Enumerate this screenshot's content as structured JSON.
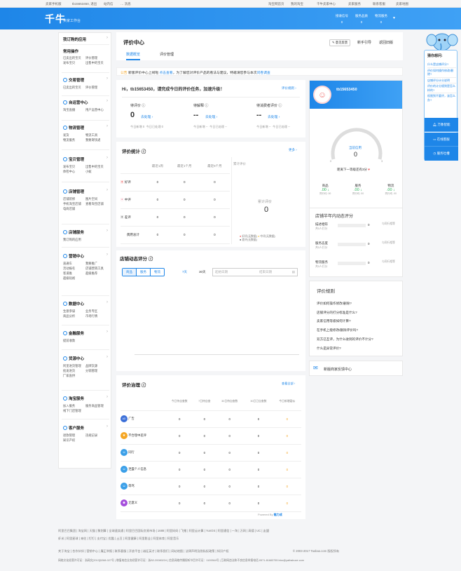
{
  "topbar": {
    "left": [
      "卖家手机版",
      "tb15653450, 退出",
      "站内信",
      "… 消息"
    ],
    "right": [
      "淘宝网首页",
      "我的淘宝",
      "千牛卖家中心",
      "卖家服务",
      "联系客服",
      "卖家地图"
    ]
  },
  "header": {
    "logo": "千牛",
    "sublogo": "卖家工作台",
    "stats": [
      {
        "label": "接收信号",
        "value": "0"
      },
      {
        "label": "服务品质",
        "value": "0"
      },
      {
        "label": "物流服务",
        "value": "0"
      }
    ]
  },
  "sidebar": {
    "top": "我订购的应用",
    "sections": [
      {
        "title": "常用操作",
        "items": [
          "已卖出的宝贝",
          "评价管理",
          "发布宝贝",
          "出售中的宝贝"
        ]
      },
      {
        "title": "交易管理",
        "items": [
          "已卖出的宝贝",
          "评价管理"
        ]
      },
      {
        "title": "自运营中心",
        "items": [
          "淘宝直播",
          "用户运营中心"
        ]
      },
      {
        "title": "物流管理",
        "items": [
          "发货",
          "物流工具",
          "物流服务",
          "我要寄快递"
        ]
      },
      {
        "title": "宝贝管理",
        "items": [
          "发布宝贝",
          "出售中的宝贝",
          "体检中心",
          "小蚁"
        ]
      },
      {
        "title": "店铺管理",
        "items": [
          "店铺装修",
          "图片空间",
          "手机淘宝店铺",
          "查看淘宝店铺",
          "电商店铺"
        ]
      },
      {
        "title": "店铺服务",
        "items": [
          "我订购的应用"
        ]
      },
      {
        "title": "营销中心",
        "items": [
          "直通车",
          "我要推广",
          "活动报名",
          "店铺营销工具",
          "客道推",
          "超级推荐",
          "超级短视"
        ]
      },
      {
        "title": "数据中心",
        "items": [
          "生意参谋",
          "业务专区",
          "商品分析",
          "市场行情"
        ]
      },
      {
        "title": "金融服务",
        "items": [
          "提前收款"
        ]
      },
      {
        "title": "货源中心",
        "items": [
          "阿里进货管理",
          "品牌货源",
          "批发进货",
          "分销管理",
          "厂家直供"
        ]
      },
      {
        "title": "淘宝服务",
        "items": [
          "加入服务",
          "服务商品管理",
          "线下门店管理"
        ]
      },
      {
        "title": "客户服务",
        "items": [
          "退款管理",
          "违规记录",
          "知识产权"
        ]
      }
    ]
  },
  "main": {
    "title": "评价中心",
    "tabs": [
      "数据概览",
      "评价管理"
    ],
    "actions": [
      "意见反馈",
      "新手引导",
      "返回旧版"
    ],
    "notice": {
      "tag": "公告",
      "text": "新版评价中心上线啦",
      "link1": "点击查看",
      "text2": "，为了解您对评价产品的看法与建议，特邀请您参与本次",
      "link2": "问卷调查"
    },
    "greeting": "Hi，tb15653450，请完成今日的评价任务，加速升级！",
    "rules_link": "评价规则",
    "tasks": [
      {
        "label": "待评价",
        "value": "0",
        "action": "去处理",
        "sub1": "今日新增 0",
        "sub2": "今日已处理 0"
      },
      {
        "label": "待解释",
        "value": "--",
        "action": "去处理",
        "sub1": "今日新增 --",
        "sub2": "今日已处理 --"
      },
      {
        "label": "待消费者评价",
        "value": "--",
        "action": "去处理",
        "sub1": "今日新增 --",
        "sub2": "今日已处理 --"
      }
    ],
    "stats": {
      "title": "评价统计",
      "more": "更多",
      "cols": [
        "最近1周",
        "最近1个月",
        "最近6个月"
      ],
      "rows": [
        {
          "label": "好评",
          "values": [
            "0",
            "0",
            "0"
          ]
        },
        {
          "label": "中评",
          "values": [
            "0",
            "0",
            "0"
          ]
        },
        {
          "label": "差评",
          "values": [
            "0",
            "0",
            "0"
          ]
        },
        {
          "label": "偶用总计",
          "values": [
            "0",
            "0",
            "0"
          ]
        }
      ],
      "cumulative_title": "累计评价",
      "cumulative_label": "累计评价",
      "cumulative_value": "0",
      "legend": [
        "好评(无数据)",
        "中评(无数据)",
        "差评(无数据)"
      ]
    },
    "dsr": {
      "title": "店铺动态评分",
      "buttons": [
        "商品",
        "服务",
        "物流"
      ],
      "ranges": [
        "7天",
        "30天"
      ],
      "start": "起始日期",
      "end": "结束日期"
    },
    "governance": {
      "title": "评价治理",
      "more": "查看全部",
      "cols": [
        "今日待自查数",
        "7日待自查",
        "30日待自查数",
        "30日已自查数",
        "今日新增疑似"
      ],
      "rows": [
        {
          "label": "广告",
          "icon": "AD",
          "values": [
            "0",
            "0",
            "0",
            "0",
            "0"
          ]
        },
        {
          "label": "不合理中差评",
          "icon": "★",
          "values": [
            "0",
            "0",
            "0",
            "0",
            "0"
          ]
        },
        {
          "label": "同行",
          "icon": "☺",
          "values": [
            "0",
            "0",
            "0",
            "0",
            "0"
          ]
        },
        {
          "label": "泄露个人信息",
          "icon": "☺",
          "values": [
            "0",
            "0",
            "0",
            "0",
            "0"
          ]
        },
        {
          "label": "辱骂",
          "icon": "☺",
          "values": [
            "0",
            "0",
            "0",
            "0",
            "0"
          ]
        },
        {
          "label": "无意义",
          "icon": "☻",
          "values": [
            "0",
            "0",
            "0",
            "0",
            "0"
          ]
        }
      ],
      "powered": "Powered By",
      "brand": "魅力成"
    }
  },
  "right": {
    "user": "tb15653450",
    "gauge": {
      "label": "当前信用",
      "value": "0",
      "min": "0",
      "max": "3",
      "sub": "距离下一等级还有3分"
    },
    "scores": [
      {
        "label": "商品",
        "value": ".00",
        "sub": "同行均 .00"
      },
      {
        "label": "服务",
        "value": ".00",
        "sub": "同行均 .00"
      },
      {
        "label": "物流",
        "value": ".00",
        "sub": "同行均 .00"
      }
    ],
    "half": {
      "title": "店铺半年内动态评分",
      "rows": [
        {
          "label": "描述相符",
          "sub": "共0人打分",
          "value": "0",
          "note": "与同行相等"
        },
        {
          "label": "服务态度",
          "sub": "共0人打分",
          "value": "0",
          "note": "与同行相等"
        },
        {
          "label": "物流服务",
          "sub": "共0人打分",
          "value": "0",
          "note": "与同行相等"
        }
      ]
    },
    "rules": {
      "title": "评价规则",
      "items": [
        "评价如何操作修改/删除?",
        "店铺评分的打分标准是什么?",
        "卖家信用等级如何计算?",
        "在手机上能修改/删除评价吗?",
        "双方已互评，为什么收到的评价不计分?",
        "什么是异常评价?"
      ]
    },
    "feedback": "新版商家反馈中心"
  },
  "float": {
    "title": "猜你想问:",
    "qs": [
      "什么是店铺评分?",
      "评价如何操作修改/删除?",
      "店铺评分计分说明",
      "评价的计分规则是怎么样的?",
      "权限到不要评，该怎么办?"
    ],
    "buttons": [
      "万象智能",
      "在线客服",
      "服务吐槽"
    ]
  },
  "footer": {
    "line1": "阿里巴巴集团 | 淘宝网 | 天猫 | 聚划算 | 全球速卖通 | 阿里巴巴国际交易市场 | 1688 | 阿里妈妈 | 飞猪 | 阿里云计算 | YunOS | 阿里通信 | 一淘 | 万网 | 高德 | UC | 友盟",
    "line2": "虾米 | 阿里星球 | 来往 | 钉钉 | 支付宝 | 优酷 | 土豆 | 阿里健康 | 阿里影业 | 阿里体育 | 阿里音乐",
    "line3": "关于淘宝 | 合作伙伴 | 营销中心 | 廉正举报 | 联系客服 | 开放平台 | 诚征英才 | 联系我们 | 网站地图 | 法律声明及隐私权政策 | 知识产权",
    "copyright": "© 2003-2017 Taobao.com 版权所有",
    "line4": "网络文化经营许可证：浙网文[2013]0268-027号 | 增值电信业务经营许可证：浙B2-20080224 | 信息网络传播视听节目许可证：1109364号 | 互联网违法和不良信息举报电话:0571-81683755 blxx@yathabuve.com"
  }
}
